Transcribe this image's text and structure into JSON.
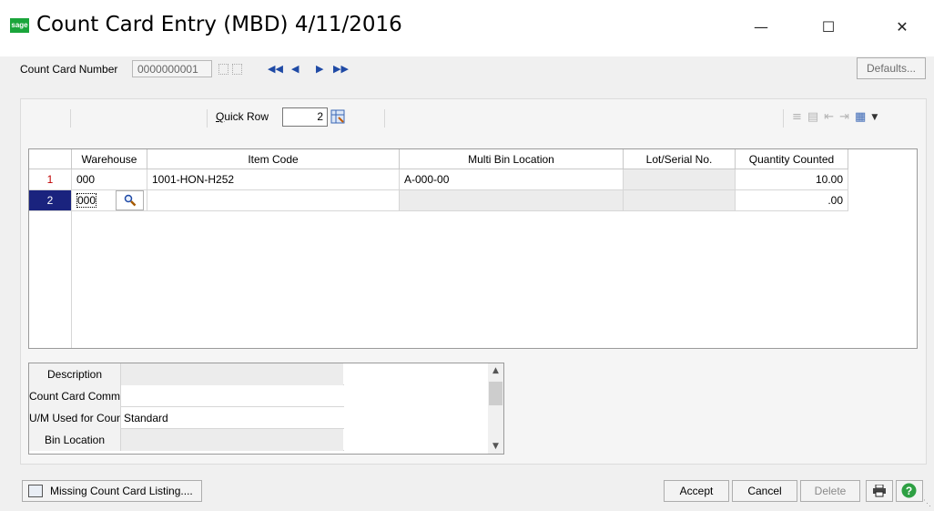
{
  "window": {
    "logo_text": "sage",
    "title": "Count Card Entry (MBD) 4/11/2016",
    "minimize": "—",
    "maximize": "☐",
    "close": "✕"
  },
  "header": {
    "count_card_label": "Count Card Number",
    "count_card_value": "0000000001",
    "defaults_label": "Defaults..."
  },
  "toolbar": {
    "quick_row_label": "Quick Row",
    "quick_row_value": "2"
  },
  "grid": {
    "columns": [
      "Warehouse",
      "Item Code",
      "Multi Bin Location",
      "Lot/Serial No.",
      "Quantity Counted"
    ],
    "rows": [
      {
        "num": "1",
        "warehouse": "000",
        "item_code": "1001-HON-H252",
        "bin": "A-000-00",
        "lot": "",
        "qty": "10.00"
      },
      {
        "num": "2",
        "warehouse": "000",
        "item_code": "",
        "bin": "",
        "lot": "",
        "qty": ".00"
      }
    ]
  },
  "details": [
    {
      "label": "Description",
      "value": ""
    },
    {
      "label": "Count Card Comment",
      "value": ""
    },
    {
      "label": "U/M Used for Count",
      "value": "Standard"
    },
    {
      "label": "Bin Location",
      "value": ""
    }
  ],
  "buttons": {
    "missing": "Missing Count Card Listing....",
    "accept": "Accept",
    "cancel": "Cancel",
    "delete": "Delete"
  },
  "colors": {
    "selected_row": "#1a237e",
    "row_number": "#c00000",
    "nav_blue": "#1f4aa5",
    "sage_green": "#1aa53b"
  }
}
